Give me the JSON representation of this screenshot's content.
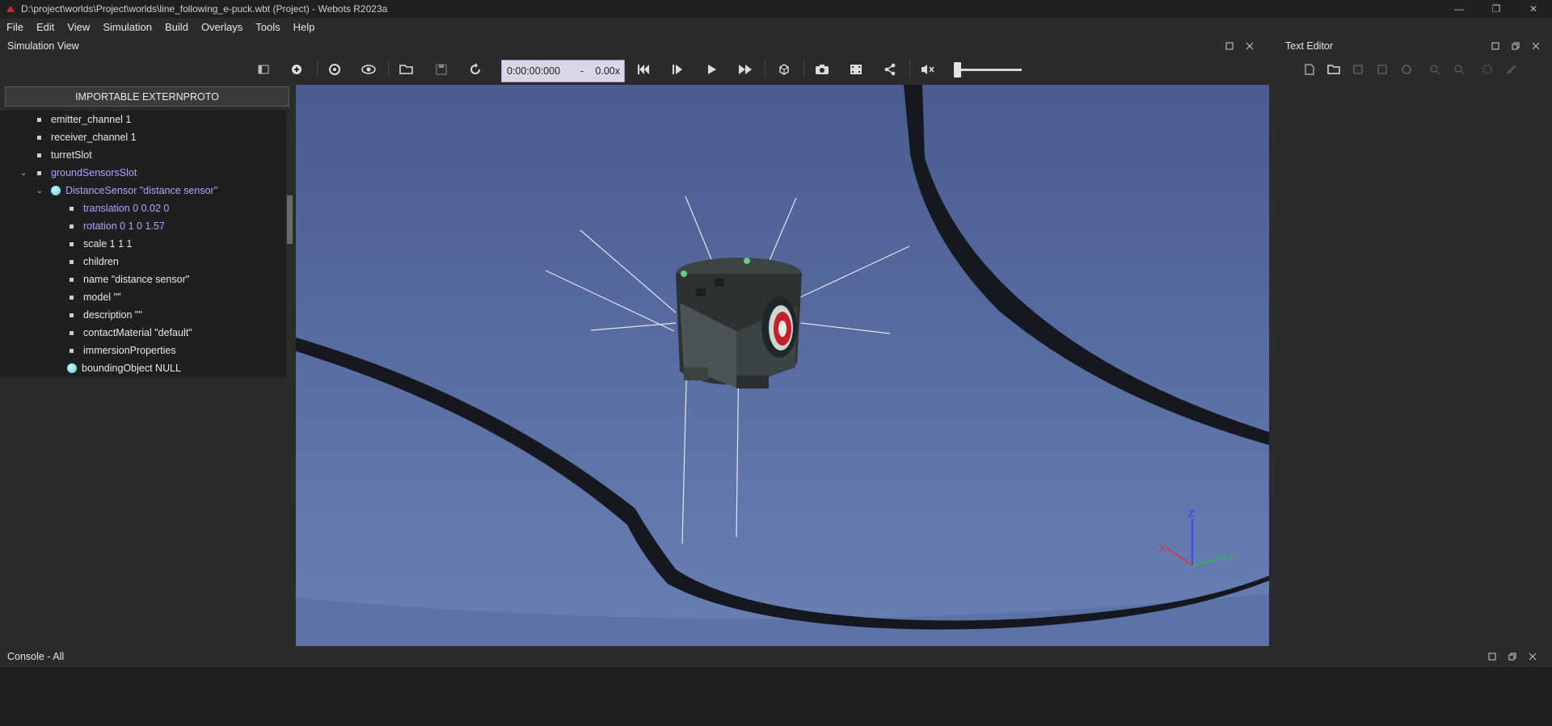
{
  "window": {
    "title": "D:\\project\\worlds\\Project\\worlds\\line_following_e-puck.wbt (Project) - Webots R2023a",
    "minimize": "—",
    "restore": "❐",
    "close": "✕"
  },
  "menu": [
    {
      "label": "File"
    },
    {
      "label": "Edit"
    },
    {
      "label": "View"
    },
    {
      "label": "Simulation"
    },
    {
      "label": "Build"
    },
    {
      "label": "Overlays"
    },
    {
      "label": "Tools"
    },
    {
      "label": "Help"
    }
  ],
  "simulation_view": {
    "title": "Simulation View",
    "time": "0:00:00:000",
    "time_separator": "-",
    "speed": "0.00x",
    "volume_level": 0.0
  },
  "scene_tree": {
    "import_button": "IMPORTABLE EXTERNPROTO",
    "rows": [
      {
        "label": "emitter_channel 1"
      },
      {
        "label": "receiver_channel 1"
      },
      {
        "label": "turretSlot"
      },
      {
        "label": "groundSensorsSlot"
      },
      {
        "label": "DistanceSensor \"distance sensor\""
      },
      {
        "label": "translation 0 0.02 0"
      },
      {
        "label": "rotation 0 1 0 1.57"
      },
      {
        "label": "scale 1 1 1"
      },
      {
        "label": "children"
      },
      {
        "label": "name \"distance sensor\""
      },
      {
        "label": "model \"\""
      },
      {
        "label": "description \"\""
      },
      {
        "label": "contactMaterial \"default\""
      },
      {
        "label": "immersionProperties"
      },
      {
        "label": "boundingObject NULL"
      }
    ]
  },
  "text_editor": {
    "title": "Text Editor"
  },
  "console": {
    "title": "Console - All"
  },
  "axes": {
    "x": "X",
    "y": "Y",
    "z": "Z"
  },
  "colors": {
    "time_box": "#d8d8e8",
    "field_blue": "#a7a7ff",
    "sky": "#5a70a6",
    "line": "#15181f"
  }
}
